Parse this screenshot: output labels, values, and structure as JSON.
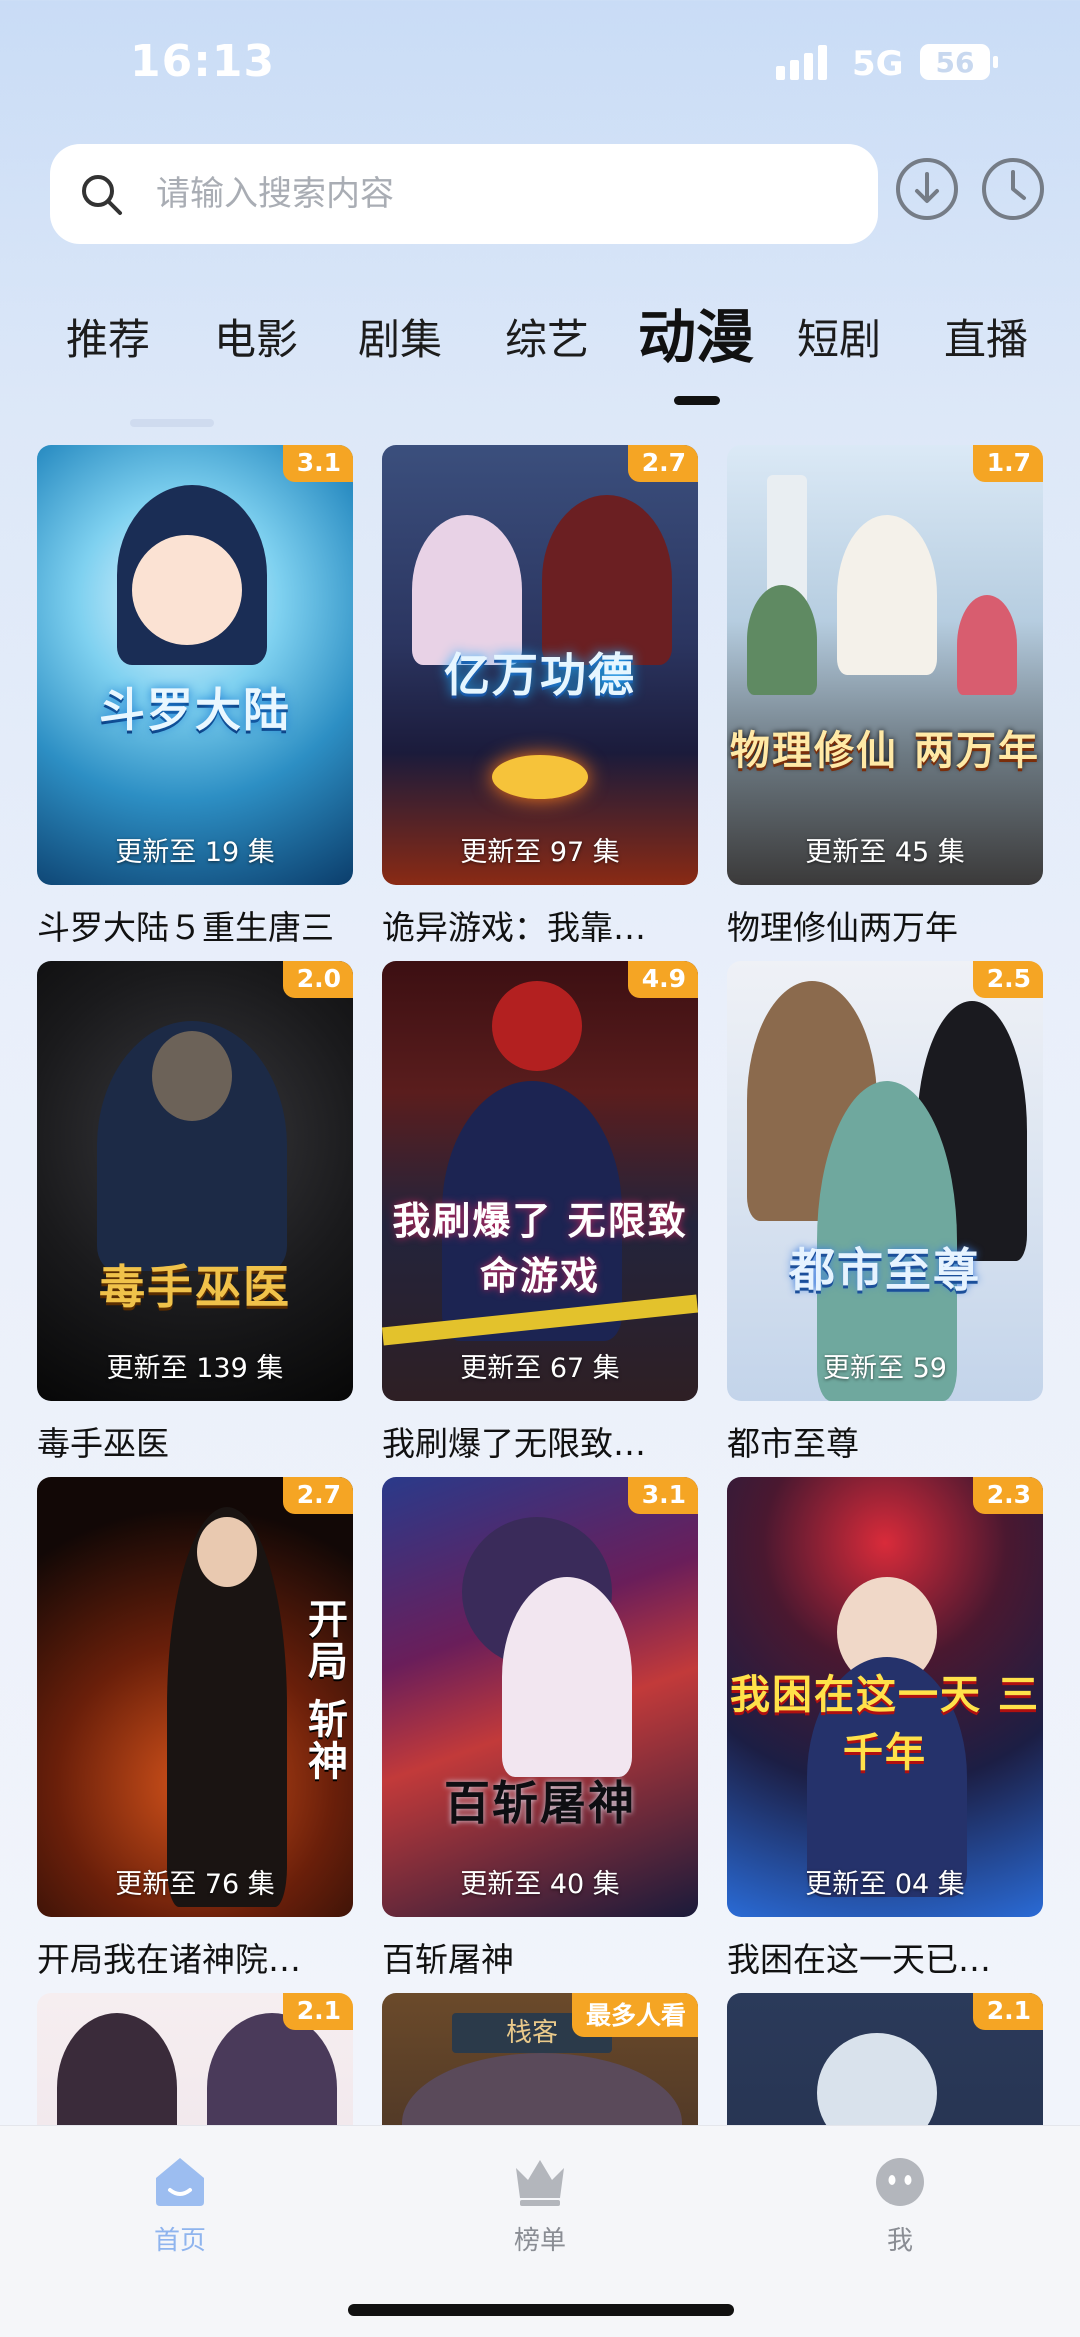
{
  "status": {
    "time": "16:13",
    "network": "5G",
    "battery": "56"
  },
  "search": {
    "placeholder": "请输入搜索内容"
  },
  "tabs": [
    {
      "label": "推荐"
    },
    {
      "label": "电影"
    },
    {
      "label": "剧集"
    },
    {
      "label": "综艺"
    },
    {
      "label": "动漫",
      "active": true
    },
    {
      "label": "短剧"
    },
    {
      "label": "直播"
    }
  ],
  "cards": [
    {
      "title": "斗罗大陆５重生唐三",
      "rating": "3.1",
      "update": "更新至 19 集"
    },
    {
      "title": "诡异游戏：我靠…",
      "rating": "2.7",
      "update": "更新至 97 集"
    },
    {
      "title": "物理修仙两万年",
      "rating": "1.7",
      "update": "更新至 45 集"
    },
    {
      "title": "毒手巫医",
      "rating": "2.0",
      "update": "更新至 139 集"
    },
    {
      "title": "我刷爆了无限致…",
      "rating": "4.9",
      "update": "更新至 67 集"
    },
    {
      "title": "都市至尊",
      "rating": "2.5",
      "update": "更新至 59"
    },
    {
      "title": "开局我在诸神院…",
      "rating": "2.7",
      "update": "更新至 76 集"
    },
    {
      "title": "百斩屠神",
      "rating": "3.1",
      "update": "更新至 40 集"
    },
    {
      "title": "我困在这一天已…",
      "rating": "2.3",
      "update": "更新至 04 集"
    },
    {
      "title": "",
      "rating": "2.1",
      "update": ""
    },
    {
      "title": "",
      "rating": "最多人看",
      "update": ""
    },
    {
      "title": "",
      "rating": "2.1",
      "update": ""
    }
  ],
  "poster_texts": [
    "斗罗大陆",
    "亿万功德",
    "物理修仙 两万年",
    "毒手巫医",
    "我刷爆了 无限致命游戏",
    "都市至尊",
    "开局 斩神",
    "百斩屠神",
    "我困在这一天 三千年",
    "",
    "栈客",
    ""
  ],
  "nav": {
    "home": "首页",
    "rank": "榜单",
    "me": "我"
  },
  "colors": {
    "accent": "#8fb4ee",
    "badge": "#f5a524"
  }
}
